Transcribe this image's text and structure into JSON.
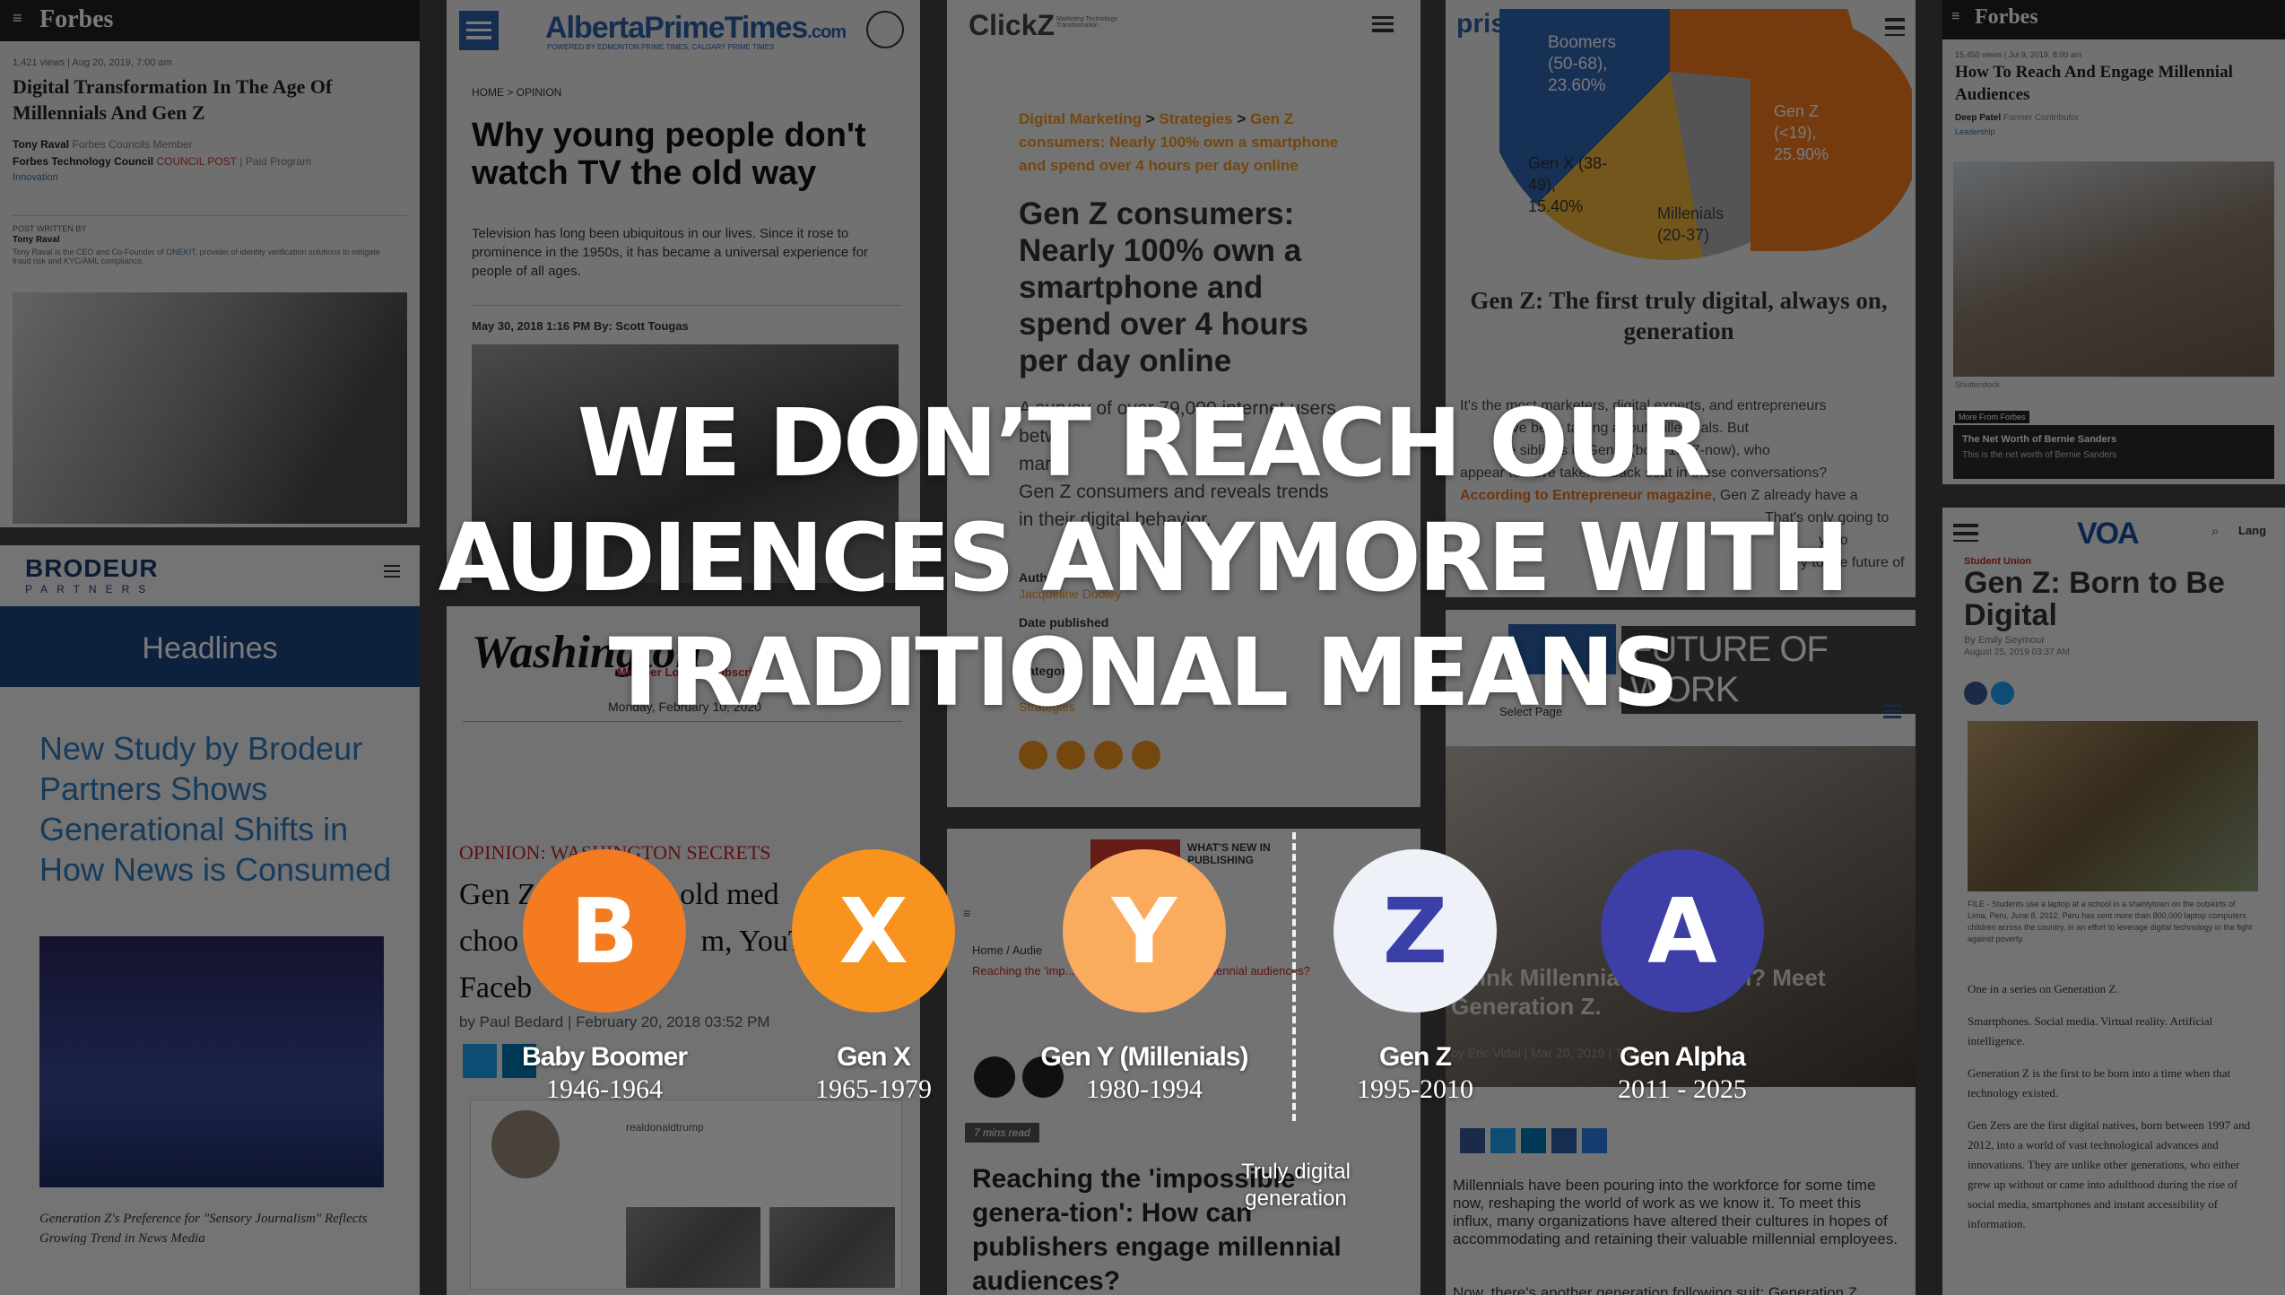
{
  "background_tiles": {
    "forbes1": {
      "logo": "Forbes",
      "meta": "1,421 views | Aug 20, 2019, 7:00 am",
      "title": "Digital Transformation In The Age Of Millennials And Gen Z",
      "author": "Tony Raval",
      "author_note": "Forbes Councils Member",
      "council": "Forbes Technology Council",
      "council_post": "COUNCIL POST",
      "paid": "| Paid Program",
      "category": "Innovation",
      "post_written_by": "POST WRITTEN BY",
      "writer_name": "Tony Raval",
      "writer_bio": "Tony Raval is the CEO and Co-Founder of",
      "writer_company": "ONEKIT",
      "writer_bio2": ", provider of identity verification solutions to mitigate fraud risk and KYC/AML compliance."
    },
    "alberta": {
      "logo": "AlbertaPrimeTimes",
      "logo_suffix": ".com",
      "tagline": "POWERED BY EDMONTON PRIME TIMES, CALGARY PRIME TIMES",
      "breadcrumb": "HOME > OPINION",
      "title": "Why young people don't watch TV the old way",
      "lede": "Television has long been ubiquitous in our lives. Since it rose to prominence in the 1950s, it has became a universal experience for people of all ages.",
      "byline": "May 30, 2018 1:16 PM By: Scott Tougas"
    },
    "clickz": {
      "logo": "ClickZ",
      "logo_sub": "Marketing Technology Transformation",
      "crumb1": "Digital Marketing",
      "crumb2": "Strategies",
      "crumb3": "Gen Z consumers: Nearly 100% own a smartphone and spend over 4 hours per day online",
      "title": "Gen Z consumers: Nearly 100% own a smartphone and spend over 4 hours per day online",
      "body1": "A survey of over 79,000 internet users",
      "body2": "betw",
      "body3": "mark",
      "body4": "Gen Z consumers and reveals trends",
      "body5": "in their digital behavior.",
      "author_label": "Auth",
      "author": "Jacqueline Dooley",
      "date_label": "Date published",
      "cat_label": "Categor",
      "cat": "Strategies"
    },
    "prism": {
      "logo": "prism",
      "pie_boomers": "Boomers (50-68), 23.60%",
      "pie_genz": "Gen Z (<19), 25.90%",
      "pie_genx": "Gen X (38-49), 15.40%",
      "pie_millenials": "Millenials (20-37)",
      "title": "Gen Z: The first truly digital, always on, generation",
      "body1": "It's the most marketers, digital experts, and entrepreneurs",
      "body2": "have been talking about millennials. But",
      "body3": "the siblings in Gen Z (born 1997-now), who",
      "body4": "appear to have taken a back seat in these conversations?",
      "link": "According to Entrepreneur magazine",
      "body5": ", Gen Z already have a",
      "body6": "That's only going to",
      "body7": "y, so",
      "body8": "y to the future of"
    },
    "forbes2": {
      "logo": "Forbes",
      "meta": "15,450 views | Jul 9, 2019, 8:00 am",
      "title": "How To Reach And Engage Millennial Audiences",
      "author": "Deep Patel",
      "author_note": "Former Contributor",
      "category": "Leadership",
      "credit": "Shutterstock",
      "more": "More From Forbes",
      "promo_title": "The Net Worth of Bernie Sanders",
      "promo_sub": "This is the net worth of Bernie Sanders"
    },
    "brodeur": {
      "logo": "BRODEUR",
      "logo_sub": "PARTNERS",
      "nav": "Headlines",
      "title": "New Study by Brodeur Partners Shows Generational Shifts in How News is Consumed",
      "caption": "Generation Z's Preference for \"Sensory Journalism\" Reflects Growing Trend in News Media"
    },
    "washington": {
      "logo": "Washington",
      "links": "Member Log In | Subscribe",
      "date": "Monday, February 10, 2020",
      "section": "OPINION: WASHINGTON SECRETS",
      "title_a": "Gen Z",
      "title_b": "s old med",
      "title_c": "choo",
      "title_d": "m, YouT",
      "title_e": "Faceb",
      "byline": "by Paul Bedard | February 20, 2018 03:52 PM",
      "tweet_handle": "realdonaldtrump"
    },
    "whatsnew": {
      "logo": "WHAT'S NEW IN PUBLISHING",
      "crumb_home": "Home",
      "crumb_audience": "Audie",
      "red_text": "Reaching the 'imp... can publishers engage millennial audiences?",
      "read_time": "7 mins read",
      "title": "Reaching the 'impossible' genera-tion': How can publishers engage millennial audiences?"
    },
    "future": {
      "banner": "FUTURE OF WORK",
      "select": "Select Page",
      "overlay_title": "Think Millennials are tough? Meet Generation Z.",
      "byline": "by Eric Vidal | Mar 20, 2019 | Trends",
      "body": "Millennials have been pouring into the workforce for some time now, reshaping the world of work as we know it. To meet this influx, many organizations have altered their cultures in hopes of accommodating and retaining their valuable millennial employees.",
      "body_link": "reshaping the world of work as we know it",
      "body_last": "Now, there's another generation following suit: Generation Z"
    },
    "voa": {
      "logo": "VOA",
      "lang": "Lang",
      "section": "Student Union",
      "title": "Gen Z: Born to Be Digital",
      "byline": "By Emily Seymour",
      "date": "August 25, 2019 03:37 AM",
      "caption": "FILE - Students use a laptop at a school in a shantytown on the outskirts of Lima, Peru, June 8, 2012. Peru has sent more than 800,000 laptop computers children across the country, in an effort to leverage digital technology in the fight against poverty.",
      "p1": "One in a series on Generation Z.",
      "p2": "Smartphones. Social media. Virtual reality. Artificial intelligence.",
      "p3": "Generation Z is the first to be born into a time when that technology existed.",
      "p4": "Gen Zers are the first digital natives, born between 1997 and 2012, into a world of vast technological advances and innovations. They are unlike other generations, who either grew up without or came into adulthood during the rise of social media, smartphones and instant accessibility of information."
    }
  },
  "headline": {
    "line1": "WE DON’T REACH OUR",
    "line2": "AUDIENCES ANYMORE WITH",
    "line3": "TRADITIONAL MEANS"
  },
  "generations": [
    {
      "letter": "B",
      "name": "Baby Boomer",
      "years": "1946-1964",
      "color": "#f47b20",
      "text_color": "#ffffff"
    },
    {
      "letter": "X",
      "name": "Gen X",
      "years": "1965-1979",
      "color": "#f7931e",
      "text_color": "#ffffff"
    },
    {
      "letter": "Y",
      "name": "Gen Y (Millenials)",
      "years": "1980-1994",
      "color": "#fbab5e",
      "text_color": "#ffffff"
    },
    {
      "letter": "Z",
      "name": "Gen Z",
      "years": "1995-2010",
      "color": "#eef1f7",
      "text_color": "#3b3fa8"
    },
    {
      "letter": "A",
      "name": "Gen Alpha",
      "years": "2011 - 2025",
      "color": "#3d3fa6",
      "text_color": "#ffffff"
    }
  ],
  "digital_label": "Truly digital generation",
  "colors": {
    "accent_orange": "#f47b20",
    "accent_indigo": "#3d3fa6",
    "overlay_text": "#ffffff"
  }
}
